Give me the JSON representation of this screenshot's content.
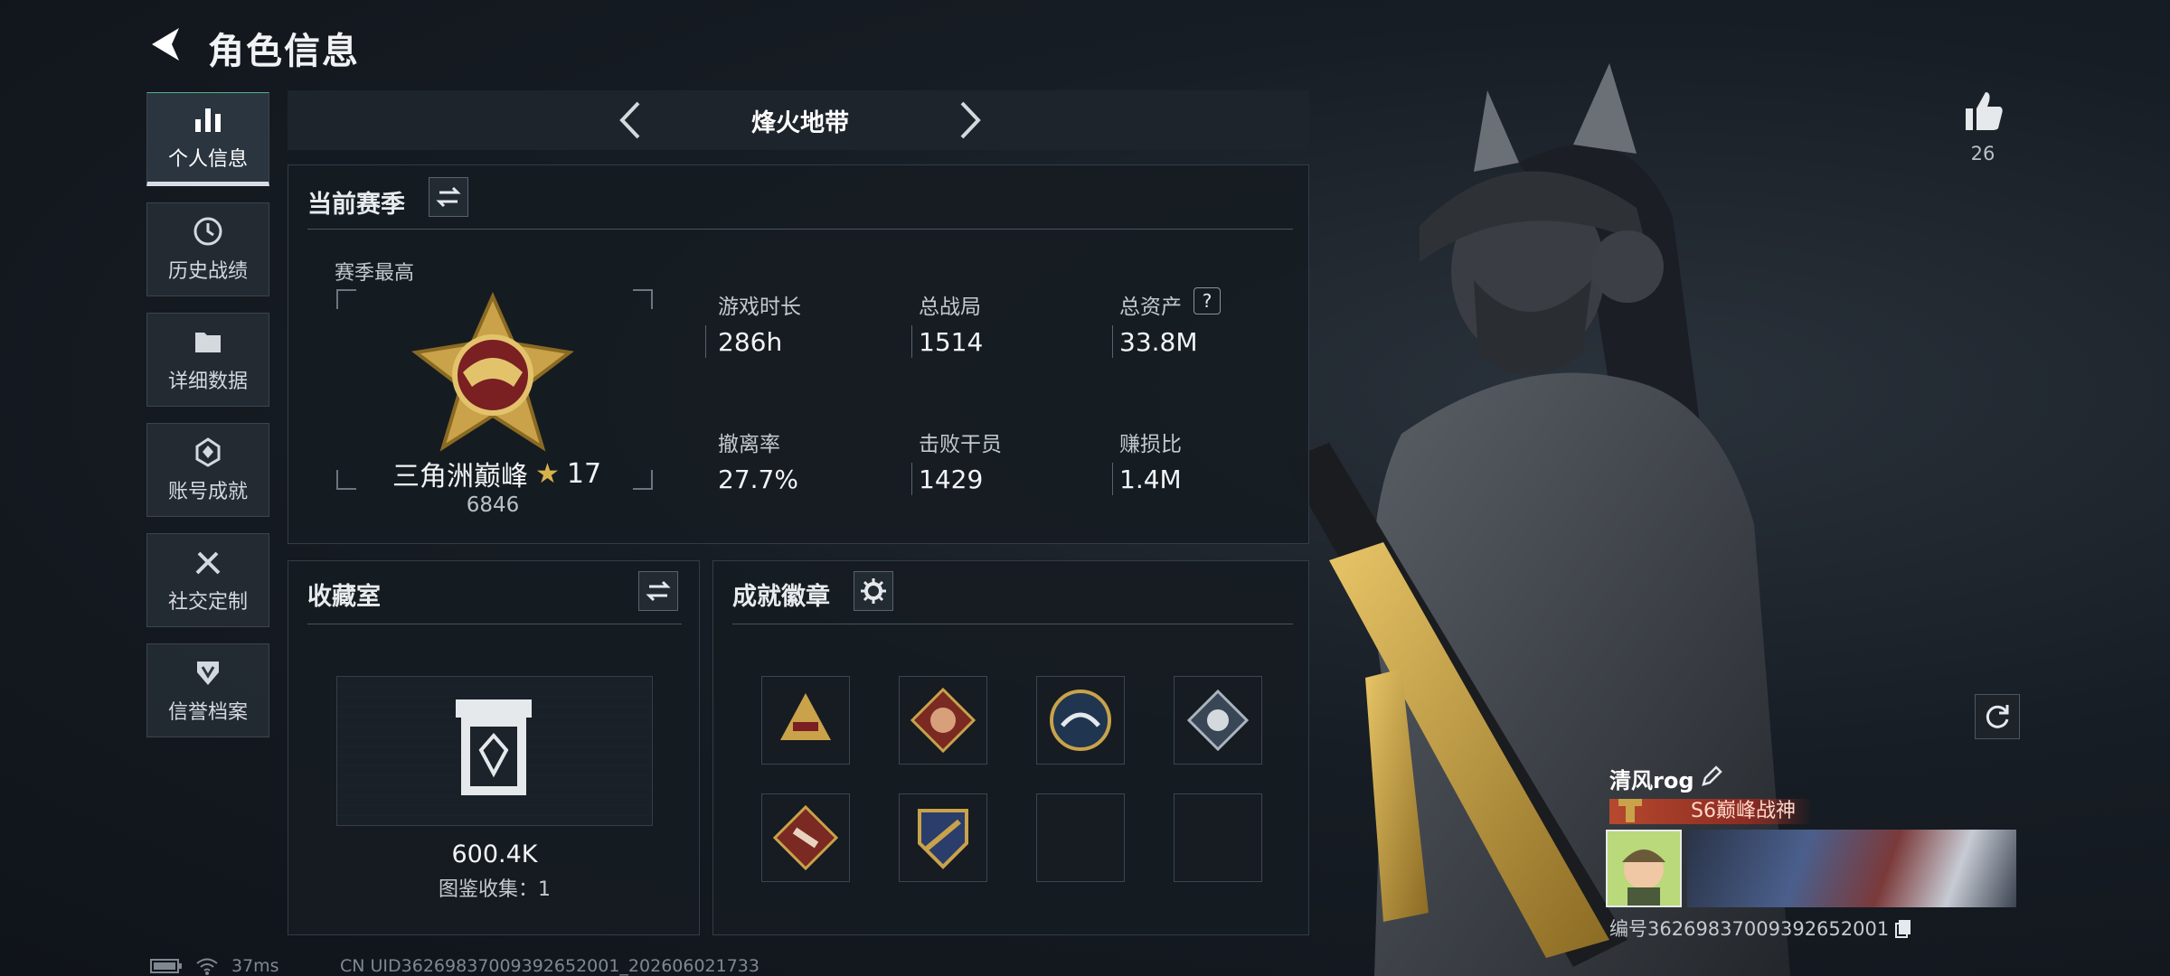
{
  "header": {
    "title": "角色信息"
  },
  "sidebar": {
    "items": [
      {
        "label": "个人信息",
        "icon": "bar-chart-icon",
        "active": true
      },
      {
        "label": "历史战绩",
        "icon": "clock-icon"
      },
      {
        "label": "详细数据",
        "icon": "folder-icon"
      },
      {
        "label": "账号成就",
        "icon": "achievement-icon"
      },
      {
        "label": "社交定制",
        "icon": "tools-icon"
      },
      {
        "label": "信誉档案",
        "icon": "shield-icon"
      }
    ]
  },
  "mode": {
    "label": "烽火地带"
  },
  "season": {
    "title": "当前赛季",
    "highest_label": "赛季最高",
    "rank_name": "三角洲巅峰",
    "rank_stars": "17",
    "rank_score": "6846",
    "stats": [
      {
        "label": "游戏时长",
        "value": "286h"
      },
      {
        "label": "总战局",
        "value": "1514"
      },
      {
        "label": "总资产",
        "value": "33.8M"
      },
      {
        "label": "撤离率",
        "value": "27.7%"
      },
      {
        "label": "击败干员",
        "value": "1429"
      },
      {
        "label": "赚损比",
        "value": "1.4M"
      }
    ],
    "help_symbol": "?"
  },
  "collection": {
    "title": "收藏室",
    "value": "600.4K",
    "count_text": "图鉴收集：1"
  },
  "achievements": {
    "title": "成就徽章"
  },
  "likes": {
    "count": "26"
  },
  "player": {
    "name": "清风rog",
    "title": "S6巅峰战神",
    "id_text": "编号3626983700939265200​1"
  },
  "status_bar": {
    "ping": "37ms",
    "uid_text": "CN UID3626983700939265200​1_202606021733"
  },
  "colors": {
    "accent_green": "#52b18a",
    "title_banner": "#8a2a22",
    "badge_gold": "#c9a24a"
  }
}
